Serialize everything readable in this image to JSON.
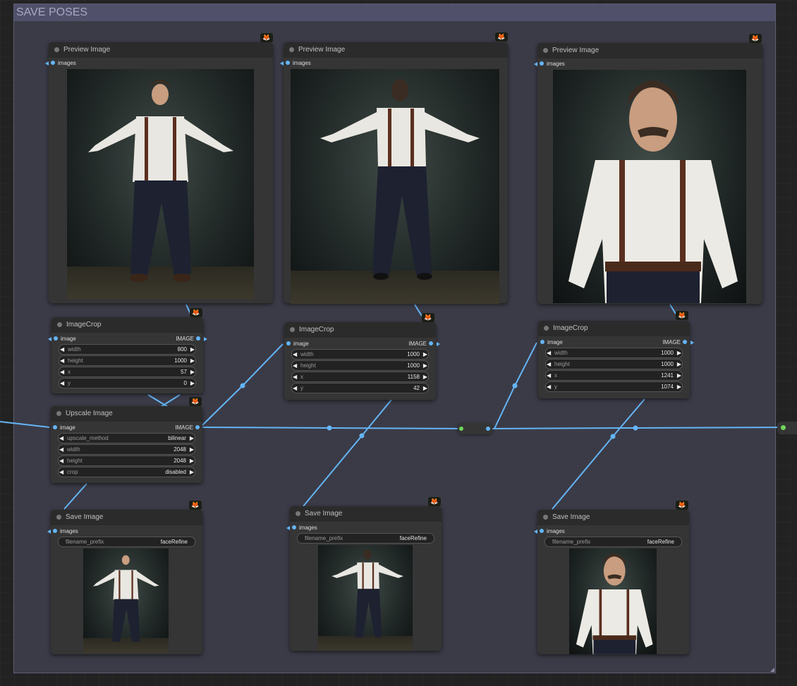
{
  "group": {
    "title": "SAVE POSES"
  },
  "badge_icon": "fox-icon",
  "colors": {
    "image_link": "#64b5f6",
    "group_bg": "#3b3b47",
    "reroute_dot": "#6fd65a"
  },
  "preview_nodes": [
    {
      "title": "Preview Image",
      "input": "images"
    },
    {
      "title": "Preview Image",
      "input": "images"
    },
    {
      "title": "Preview Image",
      "input": "images"
    }
  ],
  "crop_nodes": [
    {
      "title": "ImageCrop",
      "input": "image",
      "output": "IMAGE",
      "widgets": [
        {
          "name": "width",
          "value": "800"
        },
        {
          "name": "height",
          "value": "1000"
        },
        {
          "name": "x",
          "value": "57"
        },
        {
          "name": "y",
          "value": "0"
        }
      ]
    },
    {
      "title": "ImageCrop",
      "input": "image",
      "output": "IMAGE",
      "widgets": [
        {
          "name": "width",
          "value": "1000"
        },
        {
          "name": "height",
          "value": "1000"
        },
        {
          "name": "x",
          "value": "1158"
        },
        {
          "name": "y",
          "value": "42"
        }
      ]
    },
    {
      "title": "ImageCrop",
      "input": "image",
      "output": "IMAGE",
      "widgets": [
        {
          "name": "width",
          "value": "1000"
        },
        {
          "name": "height",
          "value": "1000"
        },
        {
          "name": "x",
          "value": "1241"
        },
        {
          "name": "y",
          "value": "1074"
        }
      ]
    }
  ],
  "upscale": {
    "title": "Upscale Image",
    "input": "image",
    "output": "IMAGE",
    "widgets": [
      {
        "name": "upscale_method",
        "value": "bilinear"
      },
      {
        "name": "width",
        "value": "2048"
      },
      {
        "name": "height",
        "value": "2048"
      },
      {
        "name": "crop",
        "value": "disabled"
      }
    ]
  },
  "save_nodes": [
    {
      "title": "Save Image",
      "input": "images",
      "widget": {
        "name": "filename_prefix",
        "value": "faceRefine"
      }
    },
    {
      "title": "Save Image",
      "input": "images",
      "widget": {
        "name": "filename_prefix",
        "value": "faceRefine"
      }
    },
    {
      "title": "Save Image",
      "input": "images",
      "widget": {
        "name": "filename_prefix",
        "value": "faceRefine"
      }
    }
  ]
}
